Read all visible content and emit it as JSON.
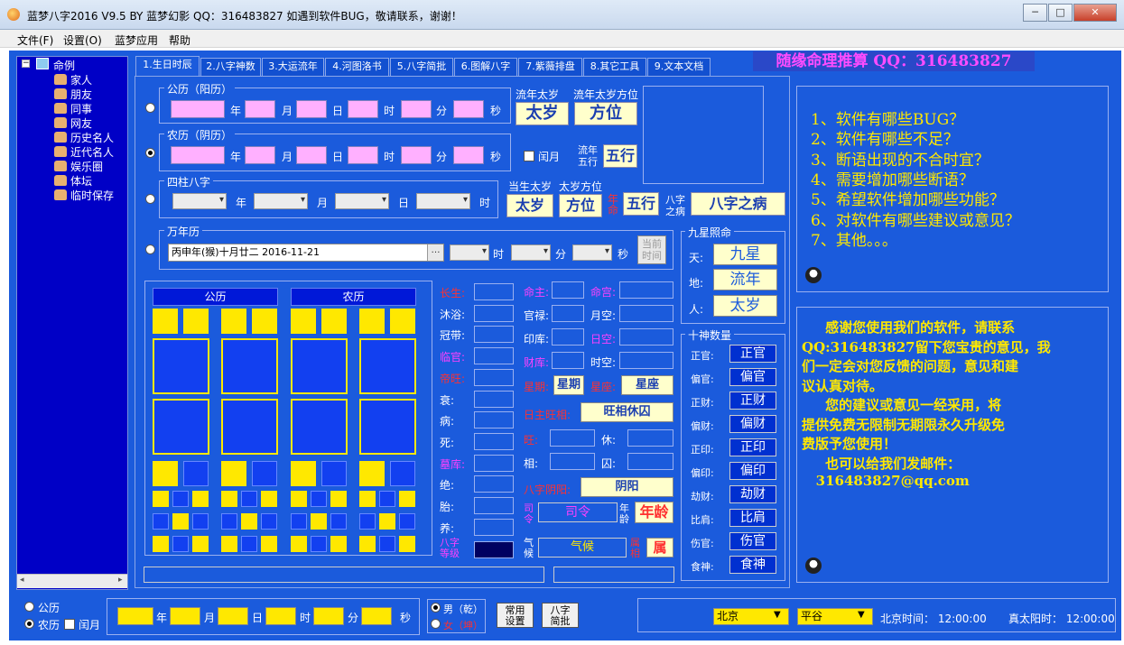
{
  "window": {
    "title": "蓝梦八字2016 V9.5 BY 蓝梦幻影 QQ：316483827  如遇到软件BUG，敬请联系，谢谢！",
    "min": "─",
    "max": "□",
    "close": "✕"
  },
  "menu": [
    "文件(F)",
    "设置(O)",
    "蓝梦应用",
    "帮助"
  ],
  "tree": {
    "root": "命例",
    "items": [
      "家人",
      "朋友",
      "同事",
      "网友",
      "历史名人",
      "近代名人",
      "娱乐圈",
      "体坛",
      "临时保存"
    ]
  },
  "tabs": [
    "1.生日时辰",
    "2.八字神数",
    "3.大运流年",
    "4.河图洛书",
    "5.八字简批",
    "6.图解八字",
    "7.紫薇排盘",
    "8.其它工具",
    "9.文本文档"
  ],
  "promo": "随缘命理推算  QQ：316483827",
  "gongli": {
    "title": "公历（阳历）",
    "units": [
      "年",
      "月",
      "日",
      "时",
      "分",
      "秒"
    ]
  },
  "nongli": {
    "title": "农历（阴历）",
    "units": [
      "年",
      "月",
      "日",
      "时",
      "分",
      "秒"
    ],
    "leap": "闰月"
  },
  "sizhu": {
    "title": "四柱八字",
    "units": [
      "年",
      "月",
      "日",
      "时"
    ]
  },
  "wannian": {
    "title": "万年历",
    "date": "丙申年(猴)十月廿二  2016-11-21",
    "units": [
      "时",
      "分",
      "秒"
    ],
    "now_btn": "当前\n时间"
  },
  "top_right": {
    "liunian_label": "流年太岁",
    "liunian_dir_label": "流年太岁方位",
    "taisui": "太岁",
    "fangwei": "方位",
    "liunian_wuxing": "流年\n五行",
    "wuxing": "五行",
    "dangsheng_label": "当生太岁",
    "taisui_dir_label": "太岁方位",
    "taisui2": "太岁",
    "fangwei2": "方位",
    "nianming": "年命",
    "wuxing2": "五行",
    "bazi_bing_label": "八字\n之病",
    "bazi_bing": "八字之病"
  },
  "jiuxing": {
    "title": "九星照命",
    "rows": [
      {
        "label": "天:",
        "value": "九星"
      },
      {
        "label": "地:",
        "value": "流年"
      },
      {
        "label": "人:",
        "value": "太岁"
      }
    ]
  },
  "shishen": {
    "title": "十神数量",
    "rows": [
      {
        "label": "正官:",
        "value": "正官"
      },
      {
        "label": "偏官:",
        "value": "偏官"
      },
      {
        "label": "正财:",
        "value": "正财"
      },
      {
        "label": "偏财:",
        "value": "偏财"
      },
      {
        "label": "正印:",
        "value": "正印"
      },
      {
        "label": "偏印:",
        "value": "偏印"
      },
      {
        "label": "劫财:",
        "value": "劫财"
      },
      {
        "label": "比肩:",
        "value": "比肩"
      },
      {
        "label": "伤官:",
        "value": "伤官"
      },
      {
        "label": "食神:",
        "value": "食神"
      }
    ]
  },
  "chart": {
    "gongli": "公历",
    "nongli": "农历"
  },
  "changsheng": [
    {
      "t": "长生:",
      "c": "#ff3030"
    },
    {
      "t": "沐浴:",
      "c": "#ffffff"
    },
    {
      "t": "冠带:",
      "c": "#ffffff"
    },
    {
      "t": "临官:",
      "c": "#ff40ff"
    },
    {
      "t": "帝旺:",
      "c": "#ff3030"
    },
    {
      "t": "衰:",
      "c": "#ffffff"
    },
    {
      "t": "病:",
      "c": "#ffffff"
    },
    {
      "t": "死:",
      "c": "#ffffff"
    },
    {
      "t": "墓库:",
      "c": "#ff40ff"
    },
    {
      "t": "绝:",
      "c": "#ffffff"
    },
    {
      "t": "胎:",
      "c": "#ffffff"
    },
    {
      "t": "养:",
      "c": "#ffffff"
    }
  ],
  "mid": {
    "mingzhu": "命主:",
    "guanlu": "官禄:",
    "yinku": "印库:",
    "caiku": "财库:",
    "xingqi_label": "星期:",
    "xingqi": "星期",
    "mingong": "命宫:",
    "yuekong": "月空:",
    "rikong": "日空:",
    "shikong": "时空:",
    "xingzuo_label": "星座:",
    "xingzuo": "星座",
    "wangxiang_label": "日主旺相:",
    "wangxiang": "旺相休囚",
    "wang": "旺:",
    "xiu": "休:",
    "xiang": "相:",
    "qiu": "囚:",
    "yinyang_label": "八字阴阳:",
    "yinyang": "阴阳",
    "siling_label": "司令",
    "siling": "司令",
    "nianling_label": "年龄",
    "nianling": "年龄",
    "qihou_label": "气候",
    "qihou": "气候",
    "shuxiang_label": "属相",
    "shuxiang": "属",
    "dengji_label": "八字\n等级"
  },
  "qa": [
    "1、软件有哪些BUG？",
    "2、软件有哪些不足？",
    "3、断语出现的不合时宜？",
    "4、需要增加哪些断语？",
    "5、希望软件增加哪些功能？",
    "6、对软件有哪些建议或意见？",
    "7、其他。。。"
  ],
  "thanks": [
    "     感谢您使用我们的软件，请联系",
    "QQ:316483827留下您宝贵的意见，我",
    "们一定会对您反馈的问题，意见和建",
    "议认真对待。",
    "     您的建议或意见一经采用，将",
    "提供免费无限制无期限永久升级免",
    "费版予您使用！",
    "     也可以给我们发邮件：",
    "   316483827@qq.com"
  ],
  "bottom": {
    "gongli": "公历",
    "nongli": "农历",
    "leap": "闰月",
    "units": [
      "年",
      "月",
      "日",
      "时",
      "分",
      "秒"
    ],
    "male": "男（乾）",
    "female": "女（坤）",
    "setting_btn": "常用\n设置",
    "jianpi_btn": "八字\n简批",
    "city": "北京",
    "region": "平谷",
    "beijing_time": "北京时间：  12:00:00",
    "solar_time": "真太阳时：  12:00:00"
  }
}
